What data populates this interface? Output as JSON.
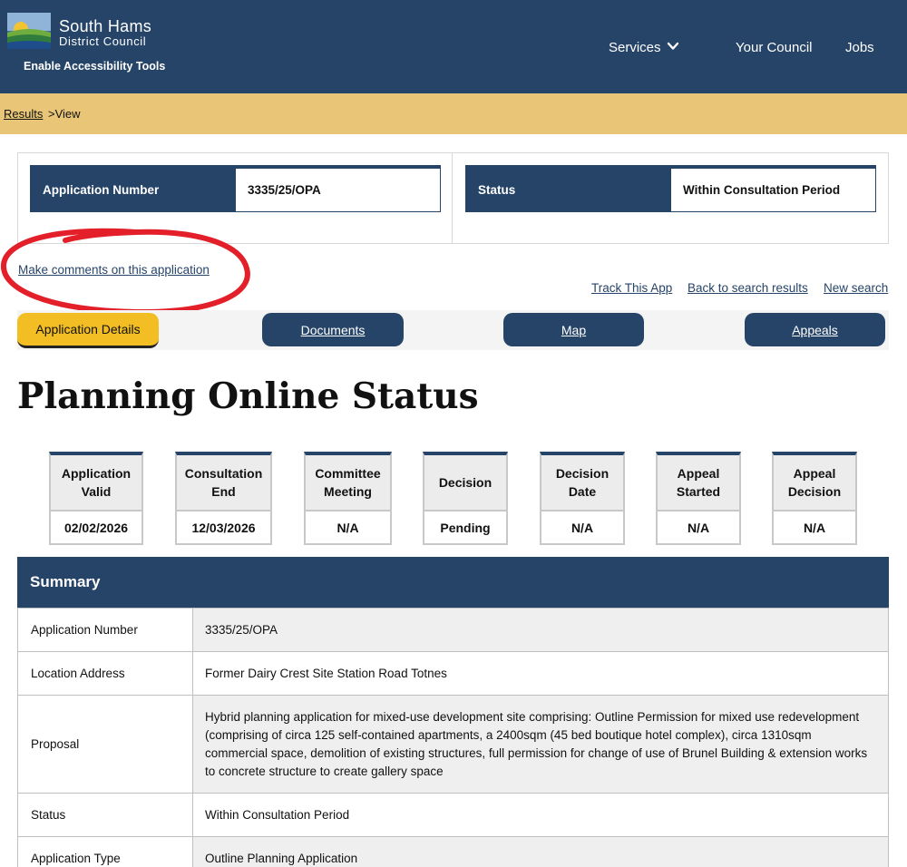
{
  "header": {
    "council_name_line1": "South Hams",
    "council_name_line2": "District Council",
    "accessibility_label": "Enable Accessibility Tools",
    "nav": {
      "services": "Services",
      "your_council": "Your Council",
      "jobs": "Jobs"
    }
  },
  "breadcrumb": {
    "results": "Results",
    "view": ">View"
  },
  "info": {
    "application_number_label": "Application Number",
    "application_number_value": "3335/25/OPA",
    "status_label": "Status",
    "status_value": "Within Consultation Period"
  },
  "links": {
    "make_comments": "Make comments on this application",
    "track": "Track This App",
    "back": "Back to search results",
    "new_search": "New search"
  },
  "tabs": {
    "details": "Application Details",
    "documents": "Documents",
    "map": "Map",
    "appeals": "Appeals"
  },
  "page_title": "Planning Online Status",
  "status_boxes": [
    {
      "title": "Application Valid",
      "value": "02/02/2026"
    },
    {
      "title": "Consultation End",
      "value": "12/03/2026"
    },
    {
      "title": "Committee Meeting",
      "value": "N/A"
    },
    {
      "title": "Decision",
      "value": "Pending"
    },
    {
      "title": "Decision Date",
      "value": "N/A"
    },
    {
      "title": "Appeal Started",
      "value": "N/A"
    },
    {
      "title": "Appeal Decision",
      "value": "N/A"
    }
  ],
  "summary": {
    "title": "Summary",
    "rows": [
      {
        "label": "Application Number",
        "value": "3335/25/OPA"
      },
      {
        "label": "Location Address",
        "value": "Former Dairy Crest Site Station Road Totnes"
      },
      {
        "label": "Proposal",
        "value": "Hybrid planning application for mixed-use development site comprising: Outline Permission for mixed use redevelopment (comprising of circa 125 self-contained apartments, a 2400sqm (45 bed boutique hotel complex), circa 1310sqm commercial space, demolition of existing structures, full permission for change of use of Brunel Building & extension works to concrete structure to create gallery space"
      },
      {
        "label": "Status",
        "value": "Within Consultation Period"
      },
      {
        "label": "Application Type",
        "value": "Outline Planning Application"
      }
    ]
  },
  "colors": {
    "brand_navy": "#264468",
    "breadcrumb_gold": "#e9c677",
    "active_tab_yellow": "#f2be24",
    "annotation_red": "#e3202a"
  },
  "icons": {
    "logo": "council-logo-icon",
    "services_chevron": "chevron-down-icon"
  }
}
